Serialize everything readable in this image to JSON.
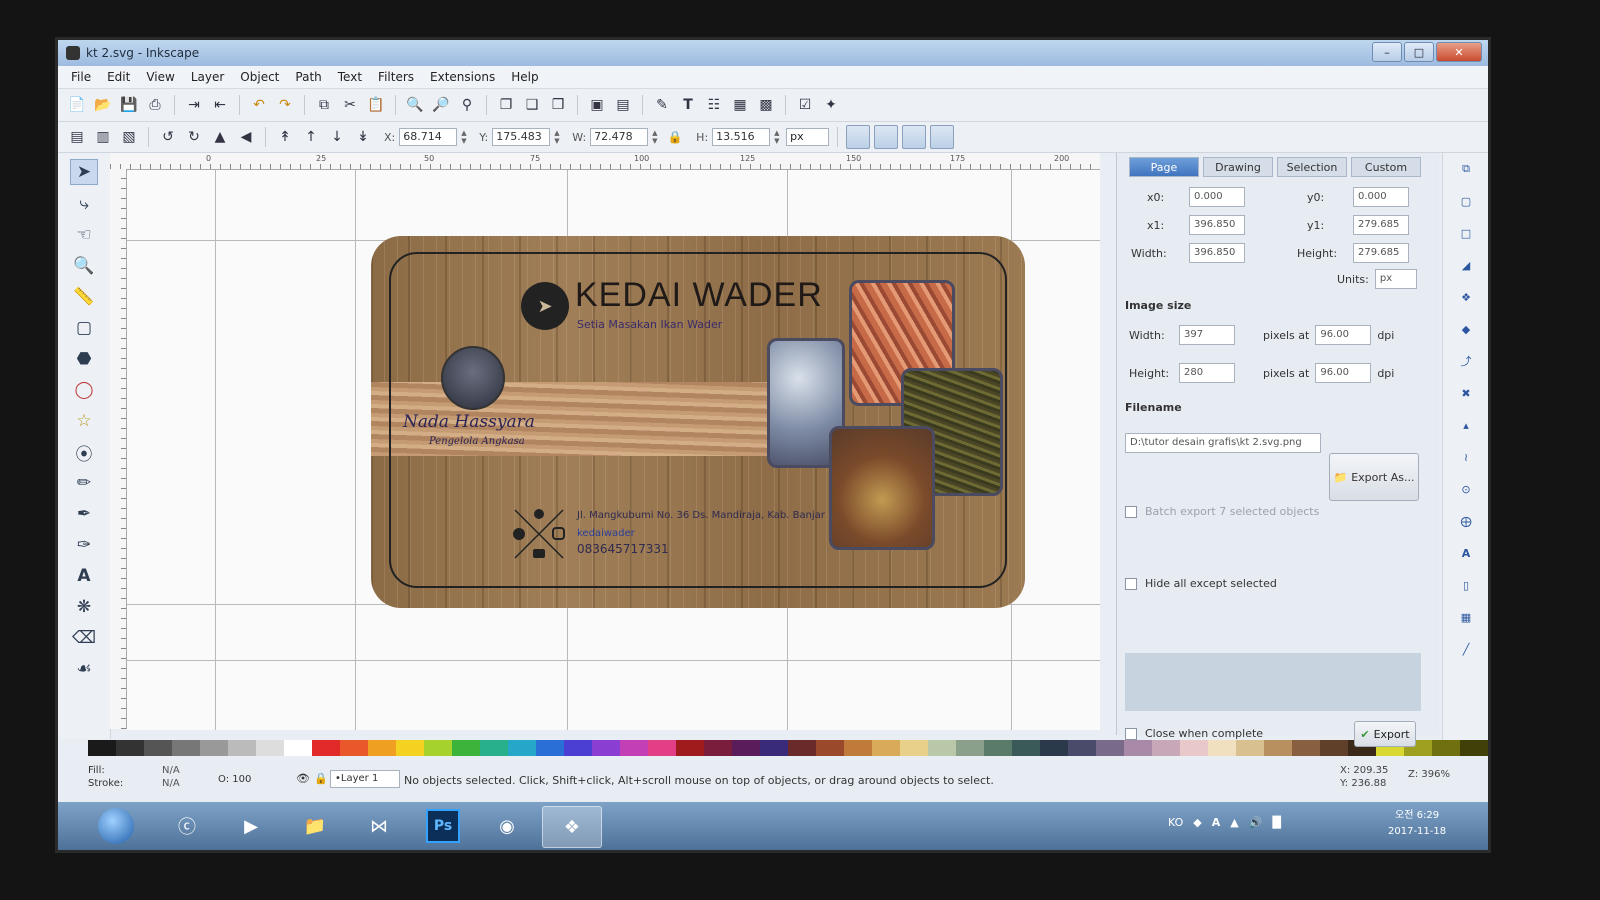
{
  "window": {
    "title": "kt 2.svg - Inkscape"
  },
  "menu": [
    "File",
    "Edit",
    "View",
    "Layer",
    "Object",
    "Path",
    "Text",
    "Filters",
    "Extensions",
    "Help"
  ],
  "toolbar_controls": {
    "x_label": "X:",
    "x_value": "68.714",
    "y_label": "Y:",
    "y_value": "175.483",
    "w_label": "W:",
    "w_value": "72.478",
    "h_label": "H:",
    "h_value": "13.516",
    "unit": "px"
  },
  "ruler": [
    "0",
    "25",
    "50",
    "75",
    "100",
    "125",
    "150",
    "175",
    "200"
  ],
  "card": {
    "brand": "KEDAI WADER",
    "tagline": "Setia Masakan Ikan Wader",
    "person_name": "Nada Hassyara",
    "person_role": "Pengelola Angkasa",
    "address": "Jl. Mangkubumi No. 36 Ds. Mandiraja, Kab. Banjar",
    "social": "kedaiwader",
    "phone": "083645717331"
  },
  "export_panel": {
    "tabs": [
      "Page",
      "Drawing",
      "Selection",
      "Custom"
    ],
    "x0_label": "x0:",
    "x0": "0.000",
    "y0_label": "y0:",
    "y0": "0.000",
    "x1_label": "x1:",
    "x1": "396.850",
    "y1_label": "y1:",
    "y1": "279.685",
    "width_label": "Width:",
    "width": "396.850",
    "height_label": "Height:",
    "height": "279.685",
    "units_label": "Units:",
    "units": "px",
    "image_size_title": "Image size",
    "img_width_label": "Width:",
    "img_width": "397",
    "img_height_label": "Height:",
    "img_height": "280",
    "pixels_at": "pixels at",
    "dpi_value": "96.00",
    "dpi_label": "dpi",
    "filename_title": "Filename",
    "filename": "D:\\tutor desain grafis\\kt 2.svg.png",
    "export_as_label": "Export As...",
    "batch_export_label": "Batch export 7 selected objects",
    "hide_all_label": "Hide all except selected",
    "close_when_complete_label": "Close when complete",
    "export_label": "Export"
  },
  "status": {
    "fill_label": "Fill:",
    "fill_value": "N/A",
    "stroke_label": "Stroke:",
    "stroke_value": "N/A",
    "opacity_label": "O:",
    "opacity_value": "100",
    "layer": "•Layer 1",
    "message": "No objects selected. Click, Shift+click, Alt+scroll mouse on top of objects, or drag around objects to select.",
    "x_coord": "X: 209.35",
    "y_coord": "Y: 236.88",
    "zoom_label": "Z:",
    "zoom": "396%"
  },
  "taskbar": {
    "ps_label": "Ps",
    "lang": "KO",
    "time": "오전 6:29",
    "date": "2017-11-18"
  },
  "palette_colors": [
    "#1a1a1a",
    "#333333",
    "#555555",
    "#777777",
    "#999999",
    "#bbbbbb",
    "#dddddd",
    "#ffffff",
    "#e22a2a",
    "#e8582a",
    "#f0a020",
    "#f3d320",
    "#a6d22e",
    "#3cb43c",
    "#27b08a",
    "#25a7c9",
    "#2a6fd6",
    "#4a3fd2",
    "#8a3fd2",
    "#c23fb6",
    "#e23f87",
    "#a01c1c",
    "#7a1c3c",
    "#5a1c5a",
    "#3a2a7a",
    "#6a2a2a",
    "#9a4a2a",
    "#c07a3a",
    "#d8aa5a",
    "#e8d08a",
    "#b8c8a8",
    "#8aa08a",
    "#5a7a6a",
    "#3a5a5a",
    "#2a3a4a",
    "#4a4a6a",
    "#7a6a8a",
    "#a88aa8",
    "#c8a8b8",
    "#e8c8c8",
    "#f0e0c0",
    "#d8c090",
    "#b89060",
    "#886040",
    "#604028",
    "#3a2818",
    "#d8d830",
    "#a0a020",
    "#707010",
    "#404008"
  ]
}
